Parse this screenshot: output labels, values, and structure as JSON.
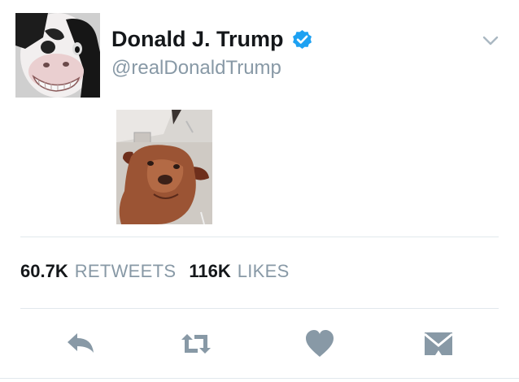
{
  "tweet": {
    "author_name": "Donald J. Trump",
    "handle": "@realDonaldTrump",
    "verified": true,
    "avatar_icon": "cow-face-avatar",
    "photo_icon": "dog-selfie-photo"
  },
  "stats": {
    "retweets_count": "60.7K",
    "retweets_label": "RETWEETS",
    "likes_count": "116K",
    "likes_label": "LIKES"
  },
  "actions": [
    "reply-icon",
    "retweet-icon",
    "like-icon",
    "direct-message-icon"
  ],
  "colors": {
    "text_primary": "#14171a",
    "text_secondary": "#8899a6",
    "verified_blue": "#1da1f2",
    "icon_gray": "#8899a6",
    "divider": "#e1e8ed"
  }
}
